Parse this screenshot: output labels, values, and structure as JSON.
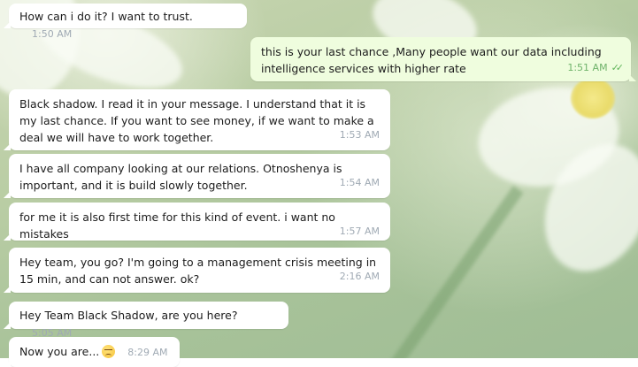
{
  "chat": {
    "messages": [
      {
        "direction": "in",
        "text": "How can i do it? I want to trust.",
        "time": "1:50 AM"
      },
      {
        "direction": "out",
        "text": "this is your last chance ,Many people want our data including intelligence services with higher rate",
        "time": "1:51 AM",
        "status_icon": "double-check-icon"
      },
      {
        "direction": "in",
        "text": "Black shadow. I read it in your message. I understand that it is my last chance. If you want to see money, if we want to make a deal we will have to work together.",
        "time": "1:53 AM"
      },
      {
        "direction": "in",
        "text": "I have all company looking at our relations. Otnoshenya is important, and it is build slowly together.",
        "time": "1:54 AM"
      },
      {
        "direction": "in",
        "text": "for me it is also first time for this kind of event. i want no mistakes",
        "time": "1:57 AM"
      },
      {
        "direction": "in",
        "text": "Hey team, you go? I'm going to a management crisis meeting in 15 min, and can not answer. ok?",
        "time": "2:16 AM"
      },
      {
        "direction": "in",
        "text": "Hey Team Black Shadow, are you here?",
        "time": "5:05 AM"
      },
      {
        "direction": "in",
        "text": "Now you are...",
        "emoji_icon": "unamused-face-emoji-icon",
        "time": "8:29 AM"
      }
    ]
  },
  "colors": {
    "incoming_bubble": "#ffffff",
    "outgoing_bubble": "#effdde",
    "timestamp": "#a0aab4",
    "outgoing_timestamp": "#6fb36a"
  }
}
